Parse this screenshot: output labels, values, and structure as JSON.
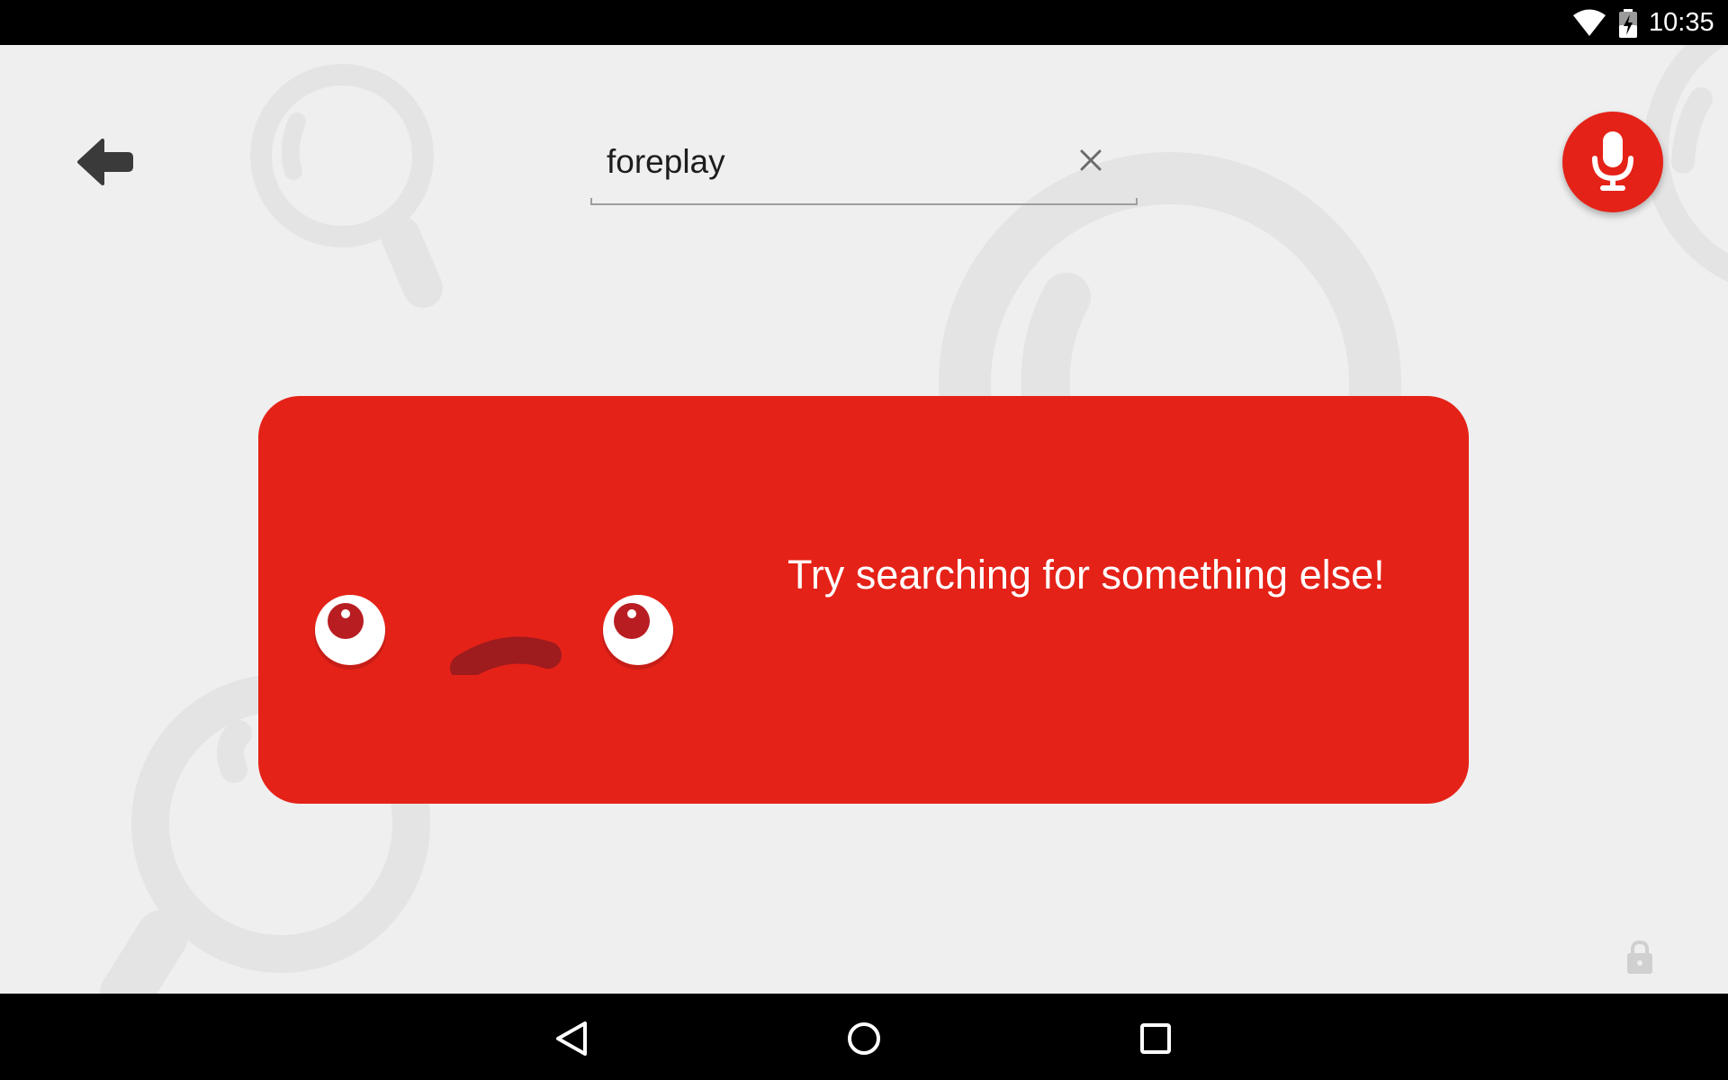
{
  "status_bar": {
    "time": "10:35",
    "icons": [
      "wifi-icon",
      "battery-charging-icon"
    ]
  },
  "search": {
    "query": "foreplay",
    "icons": {
      "back": "back-arrow-icon",
      "clear": "close-icon",
      "voice": "microphone-icon"
    }
  },
  "results": {
    "empty_message": "Try searching for something else!",
    "illustration": "sad-face-icon"
  },
  "footer": {
    "lock_icon": "lock-icon"
  },
  "nav_bar": {
    "icons": [
      "nav-back-icon",
      "nav-home-icon",
      "nav-recents-icon"
    ]
  },
  "colors": {
    "background": "#efefef",
    "accent_red": "#e52218",
    "dark_red": "#9e1b1e",
    "decor_gray": "#e4e4e4",
    "system_bar": "#000000"
  }
}
